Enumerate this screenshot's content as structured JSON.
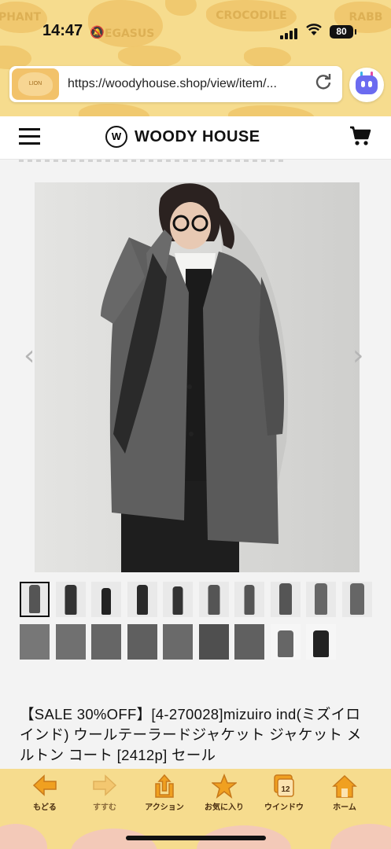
{
  "status_bar": {
    "time": "14:47",
    "battery": "80"
  },
  "background_cookies": [
    "PHANT",
    "PEGASUS",
    "CROCODILE",
    "RABB"
  ],
  "browser": {
    "url": "https://woodyhouse.shop/view/item/...",
    "lion_cookie_label": "LION"
  },
  "site_header": {
    "brand": "WOODY HOUSE",
    "logo_mark": "W"
  },
  "product": {
    "title": "【SALE 30%OFF】[4-270028]mizuiro ind(ミズイロインド) ウールテーラードジャケット ジャケット メルトン コート [2412p] セール",
    "image_nav": {
      "prev": "‹",
      "next": "›"
    },
    "thumbnails_row1": 10,
    "thumbnails_row2": 9,
    "selected_thumbnail": 1
  },
  "toolbar": {
    "items": [
      {
        "label": "もどる",
        "icon": "back-arrow-icon",
        "color": "#f0a020"
      },
      {
        "label": "すすむ",
        "icon": "forward-arrow-icon",
        "color": "#f3c770"
      },
      {
        "label": "アクション",
        "icon": "share-icon",
        "color": "#f0a020"
      },
      {
        "label": "お気に入り",
        "icon": "star-icon",
        "color": "#f0a020"
      },
      {
        "label": "ウインドウ",
        "icon": "windows-icon",
        "color": "#f0a020",
        "badge": "12"
      },
      {
        "label": "ホーム",
        "icon": "home-icon",
        "color": "#f0a020"
      }
    ]
  },
  "colors": {
    "toolbar_bg": "#f6dc8e",
    "accent": "#f0a020",
    "coat": "#5f5f5f"
  }
}
